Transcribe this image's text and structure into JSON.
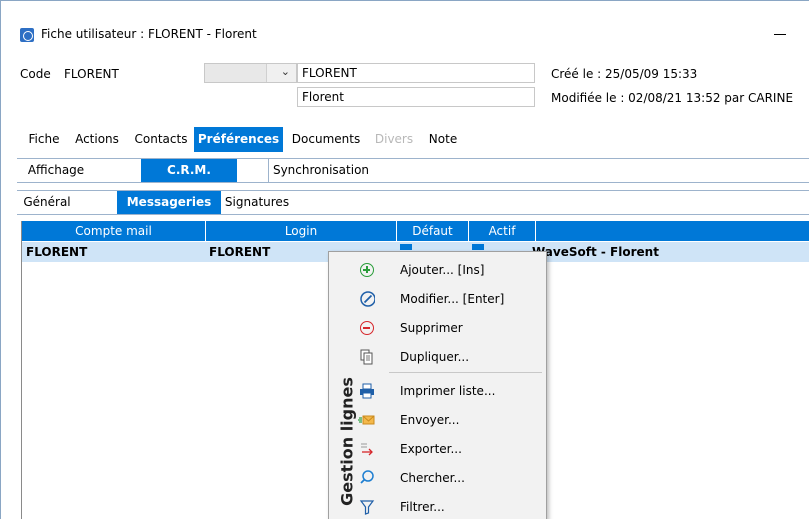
{
  "window": {
    "title": "Fiche utilisateur : FLORENT - Florent"
  },
  "header": {
    "code_label": "Code",
    "code_value": "FLORENT",
    "combo_value": "",
    "login_field": "FLORENT",
    "name_field": "Florent",
    "created": "Créé le : 25/05/09 15:33",
    "modified": "Modifiée le : 02/08/21 13:52 par CARINE"
  },
  "main_tabs": [
    {
      "label": "Fiche",
      "state": "normal"
    },
    {
      "label": "Actions",
      "state": "normal"
    },
    {
      "label": "Contacts",
      "state": "normal"
    },
    {
      "label": "Préférences",
      "state": "active"
    },
    {
      "label": "Documents",
      "state": "normal"
    },
    {
      "label": "Divers",
      "state": "disabled"
    },
    {
      "label": "Note",
      "state": "normal"
    }
  ],
  "sub_tabs": [
    {
      "label": "Affichage",
      "state": "normal"
    },
    {
      "label": "C.R.M.",
      "state": "active"
    },
    {
      "label": "Synchronisation",
      "state": "normal"
    }
  ],
  "sub_sub_tabs": [
    {
      "label": "Général",
      "state": "normal"
    },
    {
      "label": "Messageries",
      "state": "active"
    },
    {
      "label": "Signatures",
      "state": "normal"
    }
  ],
  "grid": {
    "columns": [
      "Compte mail",
      "Login",
      "Défaut",
      "Actif",
      ""
    ],
    "rows": [
      {
        "compte": "FLORENT",
        "login": "FLORENT",
        "defaut": true,
        "actif": true,
        "nom": "WaveSoft - Florent"
      }
    ]
  },
  "context_menu": {
    "side_label": "Gestion lignes",
    "items": [
      {
        "label": "Ajouter... [Ins]",
        "icon": "add-icon"
      },
      {
        "label": "Modifier... [Enter]",
        "icon": "edit-icon"
      },
      {
        "label": "Supprimer",
        "icon": "delete-icon"
      },
      {
        "label": "Dupliquer...",
        "icon": "duplicate-icon"
      },
      {
        "label": "Imprimer liste...",
        "icon": "print-icon"
      },
      {
        "label": "Envoyer...",
        "icon": "send-icon"
      },
      {
        "label": "Exporter...",
        "icon": "export-icon"
      },
      {
        "label": "Chercher...",
        "icon": "search-icon"
      },
      {
        "label": "Filtrer...",
        "icon": "filter-icon"
      }
    ]
  },
  "colors": {
    "accent": "#0078d7",
    "selected_row": "#cfe4f7",
    "add_green": "#2a9d3a",
    "edit_blue": "#1f5fa8",
    "delete_red": "#d6262b"
  }
}
